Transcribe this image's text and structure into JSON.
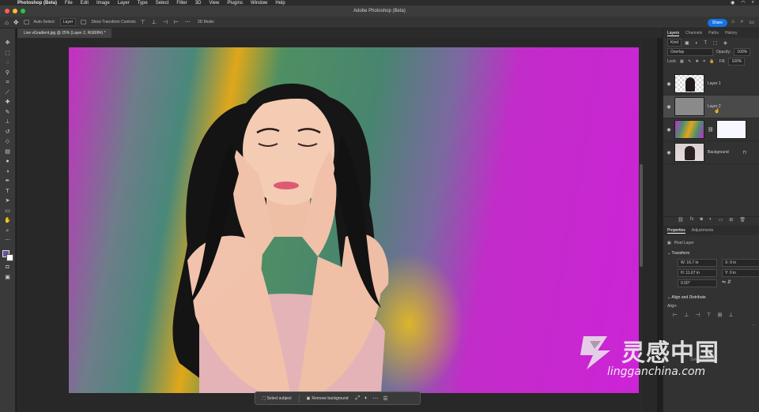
{
  "menubar": {
    "app_name": "Photoshop (Beta)",
    "items": [
      "File",
      "Edit",
      "Image",
      "Layer",
      "Type",
      "Select",
      "Filter",
      "3D",
      "View",
      "Plugins",
      "Window",
      "Help"
    ]
  },
  "window": {
    "title": "Adobe Photoshop (Beta)"
  },
  "options": {
    "auto_select_label": "Auto-Select:",
    "auto_select_value": "Layer",
    "transform_label": "Show Transform Controls",
    "mode_3d": "3D Mode:",
    "share_label": "Share"
  },
  "document": {
    "tab_label": "Live vGradient.jpg @ 25% (Layer 2, RGB/8#) *"
  },
  "layers_panel": {
    "tabs": [
      "Layers",
      "Channels",
      "Paths",
      "History"
    ],
    "filter_value": "Kind",
    "blend_mode": "Overlay",
    "opacity_label": "Opacity:",
    "opacity_value": "100%",
    "lock_label": "Lock:",
    "fill_label": "Fill:",
    "fill_value": "100%",
    "layers": [
      {
        "name": "Layer 1",
        "thumb": "checker",
        "selected": false
      },
      {
        "name": "Layer 2",
        "thumb": "grey",
        "selected": true
      },
      {
        "name": "",
        "thumb": "grad",
        "selected": false
      },
      {
        "name": "Background",
        "thumb": "photo",
        "selected": false
      }
    ]
  },
  "properties_panel": {
    "tabs": [
      "Properties",
      "Adjustments"
    ],
    "type_label": "Pixel Layer",
    "transform_title": "Transform",
    "w_label": "W:",
    "w_value": "16.7 in",
    "x_label": "X:",
    "x_value": "0 in",
    "h_label": "H:",
    "h_value": "11.67 in",
    "y_label": "Y:",
    "y_value": "0 in",
    "angle_value": "0.00°",
    "align_title": "Align and Distribute",
    "align_label": "Align:",
    "select_subject_ghost": "Select Subject"
  },
  "taskbar": {
    "select_subject": "Select subject",
    "remove_background": "Remove background"
  },
  "watermark": {
    "chinese": "灵感中国",
    "latin": "lingganchina.com"
  },
  "colors": {
    "foreground": "#6b52a3",
    "background": "#ffffff",
    "accent": "#1473e6"
  }
}
